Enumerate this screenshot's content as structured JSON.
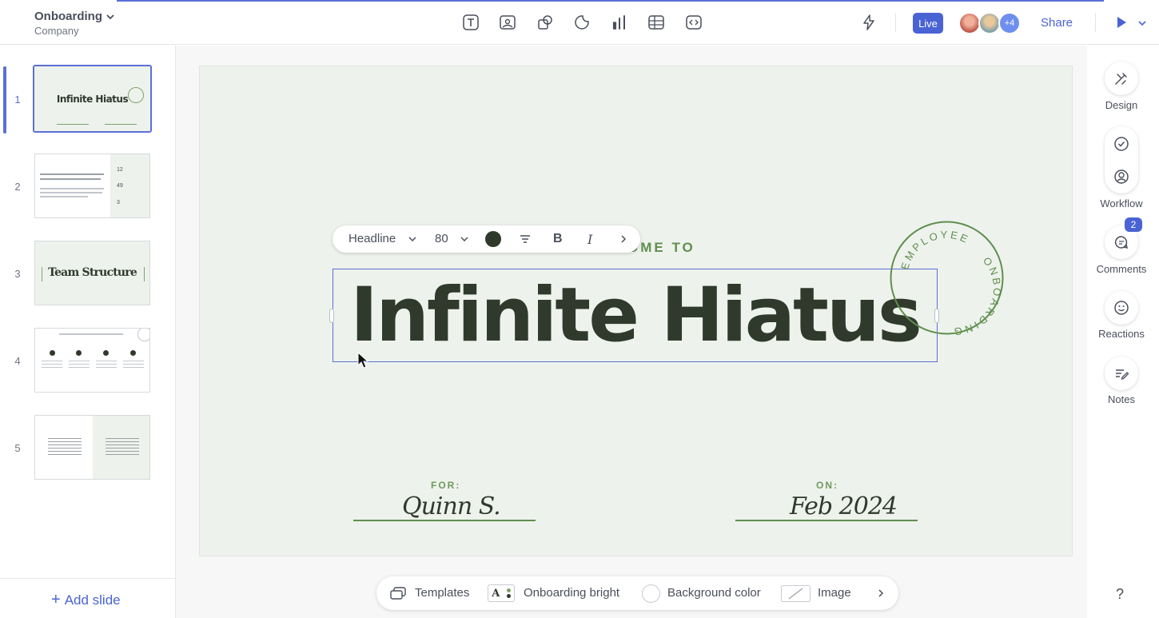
{
  "header": {
    "doc_title": "Onboarding",
    "doc_subtitle": "Company",
    "live_label": "Live",
    "collaborators_more": "+4",
    "share_label": "Share",
    "tools": [
      "text-tool-icon",
      "image-tool-icon",
      "shapes-tool-icon",
      "sticker-tool-icon",
      "chart-tool-icon",
      "table-tool-icon",
      "embed-tool-icon"
    ]
  },
  "slides_panel": {
    "slides": [
      {
        "number": "1",
        "title": "Infinite Hiatus",
        "active": true
      },
      {
        "number": "2",
        "title": "",
        "stats": [
          "12",
          "49",
          "3"
        ]
      },
      {
        "number": "3",
        "title": "Team Structure"
      },
      {
        "number": "4",
        "title": ""
      },
      {
        "number": "5",
        "title": ""
      }
    ],
    "add_slide_label": "Add slide"
  },
  "text_toolbar": {
    "style_label": "Headline",
    "font_size": "80",
    "text_color": "#2f3a2c"
  },
  "slide": {
    "welcome_text": "OME TO",
    "headline": "Infinite Hiatus",
    "stamp_text_top": "EMPLOYEE",
    "stamp_text_bottom": "ONBOARDING",
    "for_label": "FOR:",
    "for_value": "Quinn S.",
    "on_label": "ON:",
    "on_value": "Feb 2024",
    "background": "#eef2ec",
    "accent": "#5f8f4f"
  },
  "right_panel": {
    "design_label": "Design",
    "workflow_label": "Workflow",
    "comments_label": "Comments",
    "comments_count": "2",
    "reactions_label": "Reactions",
    "notes_label": "Notes",
    "help_label": "?"
  },
  "bottom_toolbar": {
    "templates_label": "Templates",
    "theme_label": "Onboarding bright",
    "background_label": "Background color",
    "image_label": "Image"
  },
  "colors": {
    "brand": "#4a63d4",
    "selection": "#5b6fd6"
  }
}
